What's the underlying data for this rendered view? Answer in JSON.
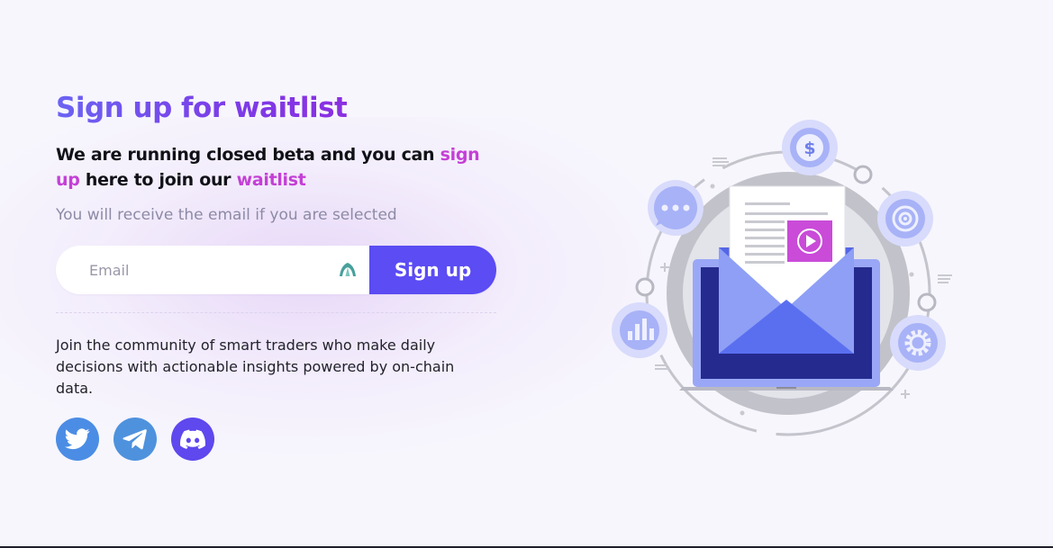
{
  "title": "Sign up for waitlist",
  "headline": {
    "part1": "We are running closed beta and you can ",
    "link1": "sign up",
    "part2": " here to join our ",
    "link2": "waitlist"
  },
  "subtitle": "You will receive the email if you are selected",
  "form": {
    "email_placeholder": "Email",
    "email_value": "",
    "signup_label": "Sign up"
  },
  "community_text": "Join the community of smart traders who make daily decisions with actionable insights powered by on-chain data.",
  "socials": [
    {
      "name": "twitter",
      "icon": "twitter-bird-icon"
    },
    {
      "name": "telegram",
      "icon": "telegram-plane-icon"
    },
    {
      "name": "discord",
      "icon": "discord-icon"
    }
  ],
  "illustration": {
    "icons": [
      "dollar-coin-icon",
      "target-icon",
      "gear-icon",
      "bar-chart-icon",
      "chat-bubble-icon",
      "play-button-icon",
      "envelope-icon",
      "laptop-icon"
    ]
  },
  "colors": {
    "title_gradient_start": "#6b63f3",
    "title_gradient_end": "#8a2fe0",
    "highlight": "#c43fd6",
    "button": "#5b4cf3",
    "twitter": "#4b8de5",
    "telegram": "#4e92dd",
    "discord": "#5e48ee"
  }
}
